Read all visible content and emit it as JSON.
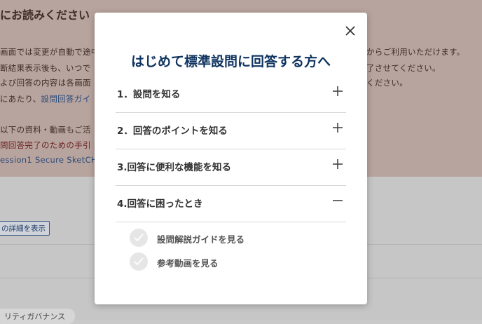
{
  "background": {
    "notice_title": "にお読みください",
    "lines": [
      {
        "text": "画面では変更が自動で途中",
        "tail": "からご利用いただけます。"
      },
      {
        "text": "断結果表示後も、いつで",
        "tail": "了させてください。"
      },
      {
        "text": "よび回答の内容は各画面",
        "tail": "ください。"
      },
      {
        "text": "にあたり、",
        "link": "設問回答ガイ"
      },
      {
        "text": "以下の資料・動画もご活"
      },
      {
        "text": "問回答完了のための手引"
      },
      {
        "text": "ession1 Secure SketCH"
      }
    ],
    "detail_button": "の詳細を表示",
    "governance_badge": "リティガバナンス"
  },
  "modal": {
    "title": "はじめて標準設問に回答する方へ",
    "close_icon": "close-icon",
    "items": [
      {
        "label": "1．設問を知る",
        "state": "collapsed",
        "icon": "plus-icon"
      },
      {
        "label": "2．回答のポイントを知る",
        "state": "collapsed",
        "icon": "plus-icon"
      },
      {
        "label": "3.回答に便利な機能を知る",
        "state": "collapsed",
        "icon": "plus-icon"
      },
      {
        "label": "4.回答に困ったとき",
        "state": "expanded",
        "icon": "minus-icon"
      }
    ],
    "sub_items": [
      {
        "label": "設問解説ガイドを見る",
        "icon": "check-icon"
      },
      {
        "label": "参考動画を見る",
        "icon": "check-icon"
      }
    ]
  },
  "colors": {
    "title": "#0f3460",
    "notice_bg": "#b8a49e",
    "link": "#2a4a7a"
  }
}
